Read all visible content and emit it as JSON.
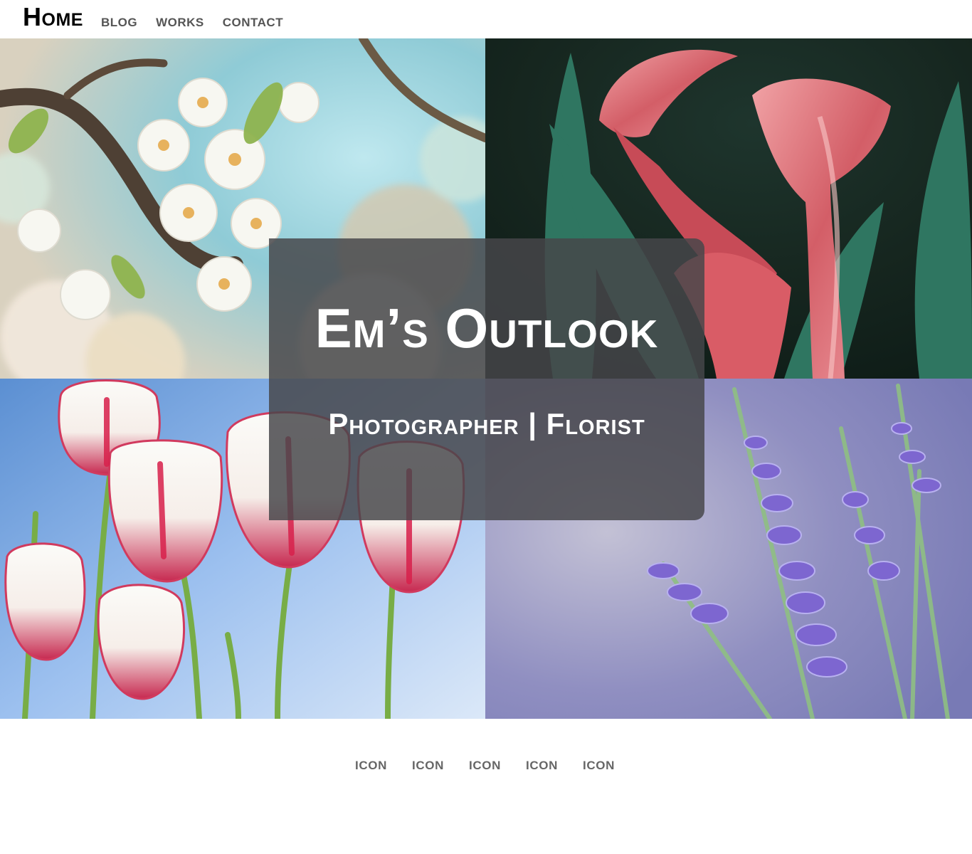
{
  "nav": {
    "home": "Home",
    "links": [
      "BLOG",
      "WORKS",
      "CONTACT"
    ]
  },
  "hero": {
    "title": "Em’s Outlook",
    "subtitle": "Photographer | Florist"
  },
  "gallery": [
    {
      "subject": "cherry-blossom-photo"
    },
    {
      "subject": "calla-lily-photo"
    },
    {
      "subject": "tulip-photo"
    },
    {
      "subject": "lavender-photo"
    }
  ],
  "footer": {
    "icons": [
      "ICON",
      "ICON",
      "ICON",
      "ICON",
      "ICON"
    ]
  },
  "colors": {
    "overlay": "#464649",
    "nav_link": "#555555",
    "footer_icon": "#666666"
  }
}
